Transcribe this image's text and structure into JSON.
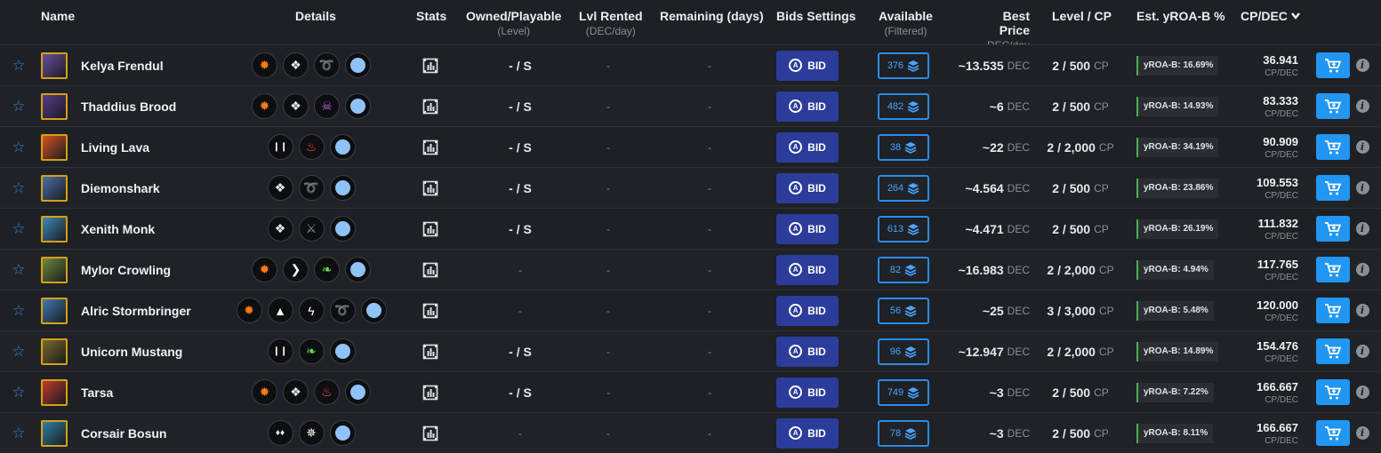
{
  "headers": {
    "name": "Name",
    "details": "Details",
    "stats": "Stats",
    "owned": "Owned/Playable",
    "owned_sub": "(Level)",
    "lvl_rented": "Lvl Rented",
    "lvl_rented_sub": "(DEC/day)",
    "remaining": "Remaining (days)",
    "bids_settings": "Bids Settings",
    "available": "Available",
    "available_sub": "(Filtered)",
    "best_price": "Best Price",
    "best_price_sub": "DEC/day",
    "level_cp": "Level / CP",
    "yroa": "Est. yROA-B %",
    "cpdec": "CP/DEC",
    "cpdec_sort_icon": "chevron-down-icon"
  },
  "labels": {
    "bid": "BID",
    "dec": "DEC",
    "cp": "CP",
    "cpdec_unit": "CP/DEC",
    "dash": "-"
  },
  "colors": {
    "bid_button": "#2c3c9a",
    "available_border": "#2e8ae6",
    "cart_button": "#2196f3",
    "yroa_accent": "#4caf50",
    "star": "#3b82d6"
  },
  "rows": [
    {
      "name": "Kelya Frendul",
      "avatar_color": "#6a4fa0",
      "details": [
        "fire-icon",
        "diamond-icon",
        "wave-icon",
        "dot-icon"
      ],
      "owned": "- / S",
      "lvl_rented": "-",
      "remaining": "-",
      "available": "376",
      "best_price": "~13.535",
      "level": "2 / 500",
      "yroa": "yROA-B: 16.69%",
      "cpdec": "36.941"
    },
    {
      "name": "Thaddius Brood",
      "avatar_color": "#5a3a8a",
      "details": [
        "fire-icon",
        "diamond-icon",
        "skull-icon",
        "dot-icon"
      ],
      "owned": "- / S",
      "lvl_rented": "-",
      "remaining": "-",
      "available": "482",
      "best_price": "~6",
      "level": "2 / 500",
      "yroa": "yROA-B: 14.93%",
      "cpdec": "83.333"
    },
    {
      "name": "Living Lava",
      "avatar_color": "#d9541e",
      "details": [
        "pause-icon",
        "flame-icon",
        "dot-icon"
      ],
      "owned": "- / S",
      "lvl_rented": "-",
      "remaining": "-",
      "available": "38",
      "best_price": "~22",
      "level": "2 / 2,000",
      "yroa": "yROA-B: 34.19%",
      "cpdec": "90.909"
    },
    {
      "name": "Diemonshark",
      "avatar_color": "#4d6fa8",
      "details": [
        "diamond-icon",
        "wave-icon",
        "dot-icon"
      ],
      "owned": "- / S",
      "lvl_rented": "-",
      "remaining": "-",
      "available": "264",
      "best_price": "~4.564",
      "level": "2 / 500",
      "yroa": "yROA-B: 23.86%",
      "cpdec": "109.553"
    },
    {
      "name": "Xenith Monk",
      "avatar_color": "#3f8ab8",
      "details": [
        "diamond-icon",
        "swords-icon",
        "dot-icon"
      ],
      "owned": "- / S",
      "lvl_rented": "-",
      "remaining": "-",
      "available": "613",
      "best_price": "~4.471",
      "level": "2 / 500",
      "yroa": "yROA-B: 26.19%",
      "cpdec": "111.832"
    },
    {
      "name": "Mylor Crowling",
      "avatar_color": "#6f8a3a",
      "details": [
        "fire-icon",
        "chevron-right-icon",
        "leaf-icon",
        "dot-icon"
      ],
      "owned": "-",
      "lvl_rented": "-",
      "remaining": "-",
      "available": "82",
      "best_price": "~16.983",
      "level": "2 / 2,000",
      "yroa": "yROA-B: 4.94%",
      "cpdec": "117.765"
    },
    {
      "name": "Alric Stormbringer",
      "avatar_color": "#3f7ab0",
      "details": [
        "fire-icon",
        "arrow-up-icon",
        "lightning-icon",
        "wave-icon",
        "dot-icon"
      ],
      "owned": "-",
      "lvl_rented": "-",
      "remaining": "-",
      "available": "56",
      "best_price": "~25",
      "level": "3 / 3,000",
      "yroa": "yROA-B: 5.48%",
      "cpdec": "120.000"
    },
    {
      "name": "Unicorn Mustang",
      "avatar_color": "#7a6a2a",
      "details": [
        "pause-icon",
        "leaf-icon",
        "dot-icon"
      ],
      "owned": "- / S",
      "lvl_rented": "-",
      "remaining": "-",
      "available": "96",
      "best_price": "~12.947",
      "level": "2 / 2,000",
      "yroa": "yROA-B: 14.89%",
      "cpdec": "154.476"
    },
    {
      "name": "Tarsa",
      "avatar_color": "#c0392b",
      "details": [
        "fire-icon",
        "diamond-icon",
        "flame-icon",
        "dot-icon"
      ],
      "owned": "- / S",
      "lvl_rented": "-",
      "remaining": "-",
      "available": "749",
      "best_price": "~3",
      "level": "2 / 500",
      "yroa": "yROA-B: 7.22%",
      "cpdec": "166.667"
    },
    {
      "name": "Corsair Bosun",
      "avatar_color": "#2f7fa8",
      "details": [
        "double-diamond-icon",
        "crosshair-icon",
        "dot-icon"
      ],
      "owned": "-",
      "lvl_rented": "-",
      "remaining": "-",
      "available": "78",
      "best_price": "~3",
      "level": "2 / 500",
      "yroa": "yROA-B: 8.11%",
      "cpdec": "166.667"
    }
  ]
}
